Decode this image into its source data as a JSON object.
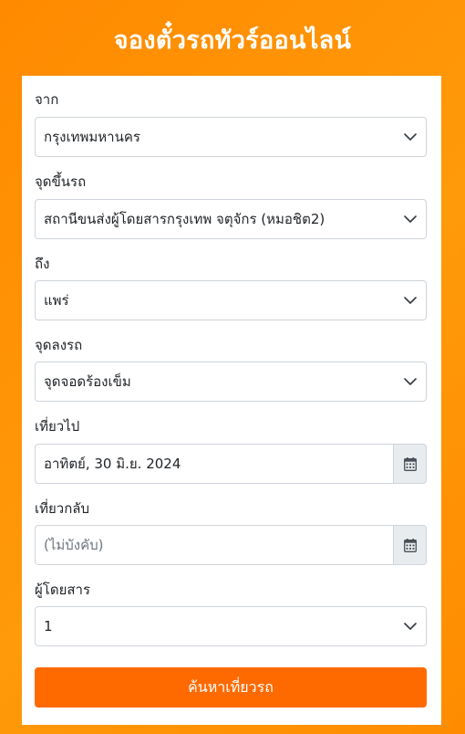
{
  "page": {
    "title": "จองตั๋วรถทัวร์ออนไลน์"
  },
  "form": {
    "origin": {
      "label": "จาก",
      "value": "กรุงเทพมหานคร"
    },
    "boarding": {
      "label": "จุดขึ้นรถ",
      "value": "สถานีขนส่งผู้โดยสารกรุงเทพ จตุจักร (หมอชิต2)"
    },
    "destination": {
      "label": "ถึง",
      "value": "แพร่"
    },
    "dropoff": {
      "label": "จุดลงรถ",
      "value": "จุดจอดร้องเข็ม"
    },
    "depart": {
      "label": "เที่ยวไป",
      "value": "อาทิตย์, 30 มิ.ย. 2024"
    },
    "return": {
      "label": "เที่ยวกลับ",
      "placeholder": "(ไม่บังคับ)"
    },
    "passengers": {
      "label": "ผู้โดยสาร",
      "value": "1"
    },
    "search_label": "ค้นหาเที่ยวรถ"
  },
  "colors": {
    "background": "#ff8a00",
    "button": "#ff6a00"
  },
  "icons": {
    "select": "chevron-down-icon",
    "date": "calendar-icon"
  }
}
